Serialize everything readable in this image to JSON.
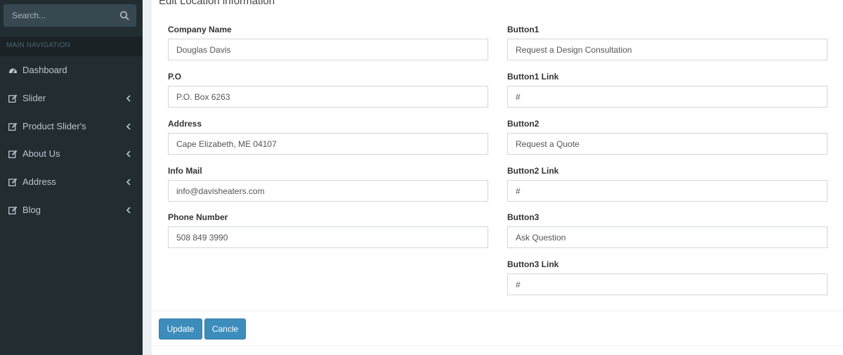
{
  "sidebar": {
    "search": {
      "placeholder": "Search...",
      "value": ""
    },
    "nav_header": "MAIN NAVIGATION",
    "items": [
      {
        "label": "Dashboard",
        "icon": "dashboard-icon",
        "has_chevron": false
      },
      {
        "label": "Slider",
        "icon": "edit-icon",
        "has_chevron": true
      },
      {
        "label": "Product Slider's",
        "icon": "edit-icon",
        "has_chevron": true
      },
      {
        "label": "About Us",
        "icon": "edit-icon",
        "has_chevron": true
      },
      {
        "label": "Address",
        "icon": "edit-icon",
        "has_chevron": true
      },
      {
        "label": "Blog",
        "icon": "edit-icon",
        "has_chevron": true
      }
    ]
  },
  "form": {
    "title": "Edit Location information",
    "left": [
      {
        "label": "Company Name",
        "value": "Douglas Davis"
      },
      {
        "label": "P.O",
        "value": "P.O. Box 6263"
      },
      {
        "label": "Address",
        "value": "Cape Elizabeth, ME 04107"
      },
      {
        "label": "Info Mail",
        "value": "info@davisheaters.com"
      },
      {
        "label": "Phone Number",
        "value": "508 849 3990"
      }
    ],
    "right": [
      {
        "label": "Button1",
        "value": "Request a Design Consultation"
      },
      {
        "label": "Button1 Link",
        "value": "#"
      },
      {
        "label": "Button2",
        "value": "Request a Quote"
      },
      {
        "label": "Button2 Link",
        "value": "#"
      },
      {
        "label": "Button3",
        "value": "Ask Question"
      },
      {
        "label": "Button3 Link",
        "value": "#"
      }
    ],
    "update_label": "Update",
    "cancel_label": "Cancle"
  },
  "colors": {
    "sidebar_bg": "#222d32",
    "accent": "#3c8dbc",
    "content_bg": "#ecf0f5"
  }
}
